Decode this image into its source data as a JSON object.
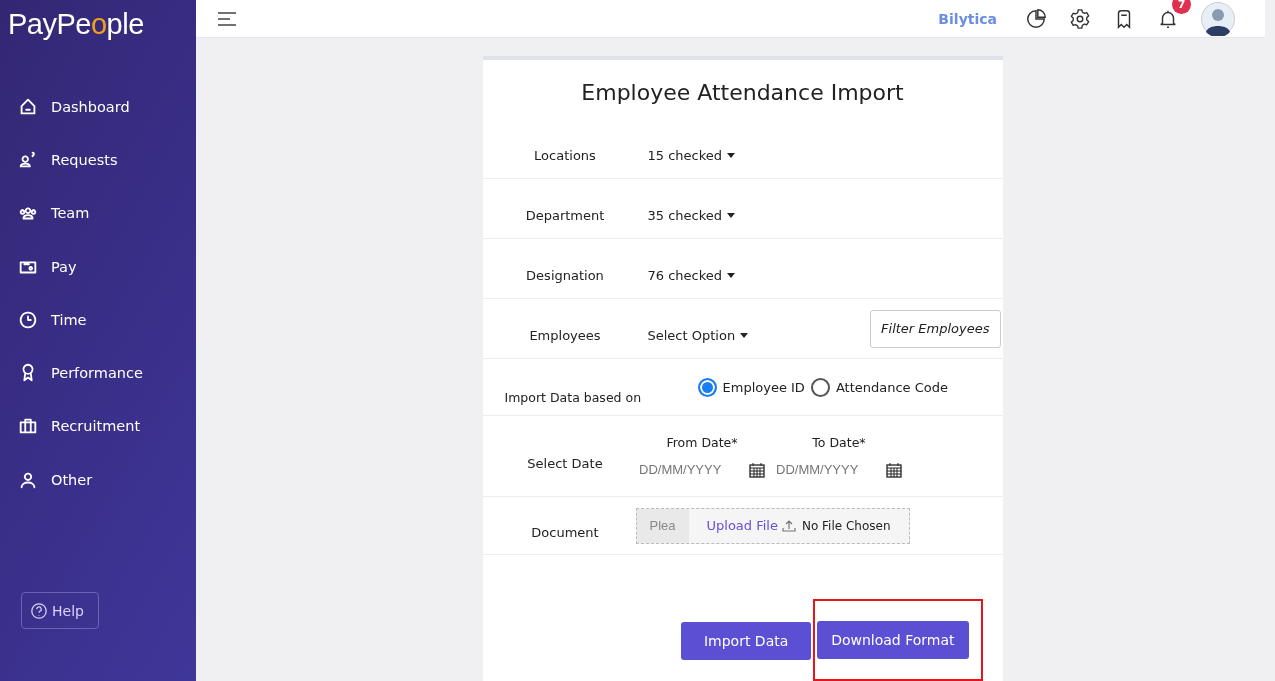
{
  "sidebar": {
    "logo_parts": [
      "PayPe",
      "o",
      "ple"
    ],
    "items": [
      {
        "label": "Dashboard"
      },
      {
        "label": "Requests"
      },
      {
        "label": "Team"
      },
      {
        "label": "Pay"
      },
      {
        "label": "Time"
      },
      {
        "label": "Performance"
      },
      {
        "label": "Recruitment"
      },
      {
        "label": "Other"
      }
    ],
    "help": "Help"
  },
  "topbar": {
    "company": "Bilytica",
    "notification_count": "7"
  },
  "form": {
    "title": "Employee Attendance Import",
    "fields": [
      {
        "kind": "dropdown",
        "label": "Locations",
        "value": "15 checked"
      },
      {
        "kind": "dropdown",
        "label": "Department",
        "value": "35 checked"
      },
      {
        "kind": "dropdown",
        "label": "Designation",
        "value": "76 checked"
      },
      {
        "kind": "dropdown",
        "label": "Employees",
        "value": "Select Option",
        "action": "Filter Employees"
      },
      {
        "kind": "radio",
        "label": "Import Data based on",
        "options": [
          {
            "label": "Employee ID",
            "selected": true
          },
          {
            "label": "Attendance Code",
            "selected": false
          }
        ]
      },
      {
        "kind": "dates",
        "label": "Select Date",
        "dates": [
          {
            "label": "From Date*",
            "placeholder": "DD/MM/YYYY"
          },
          {
            "label": "To Date*",
            "placeholder": "DD/MM/YYYY"
          }
        ]
      },
      {
        "kind": "file",
        "label": "Document",
        "placeholder": "Plea",
        "action": "Upload File",
        "status": "No File Chosen"
      }
    ],
    "buttons": [
      {
        "label": "Import Data",
        "highlighted": false
      },
      {
        "label": "Download Format",
        "highlighted": true
      }
    ]
  }
}
